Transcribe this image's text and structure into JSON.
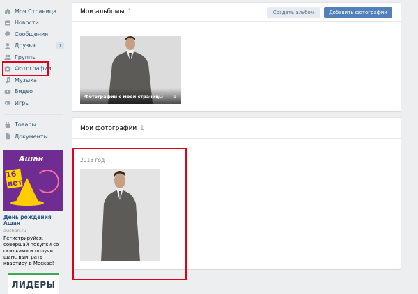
{
  "sidebar": {
    "items": [
      {
        "label": "Моя Страница",
        "icon": "home-icon"
      },
      {
        "label": "Новости",
        "icon": "news-icon"
      },
      {
        "label": "Сообщения",
        "icon": "messages-icon"
      },
      {
        "label": "Друзья",
        "icon": "friend-icon",
        "badge": "1"
      },
      {
        "label": "Группы",
        "icon": "groups-icon"
      },
      {
        "label": "Фотографии",
        "icon": "camera-icon"
      },
      {
        "label": "Музыка",
        "icon": "music-icon"
      },
      {
        "label": "Видео",
        "icon": "video-icon"
      },
      {
        "label": "Игры",
        "icon": "games-icon"
      }
    ],
    "items2": [
      {
        "label": "Товары",
        "icon": "goods-icon"
      },
      {
        "label": "Документы",
        "icon": "documents-icon"
      }
    ]
  },
  "ad": {
    "brand": "Ашан",
    "badge": "16 лет",
    "title": "День рождения Ашан",
    "domain": "auchan.ru",
    "text": "Регистрируйся, совершай покупки со скидками и получи шанс выиграть квартиру в Москве!"
  },
  "ad2": {
    "logo": "ЛИДЕРЫ"
  },
  "albums": {
    "title": "Мои альбомы",
    "count": "1",
    "create_label": "Создать альбом",
    "add_label": "Добавить фотографии",
    "album": {
      "caption": "Фотографии с моей страницы",
      "count": "1"
    }
  },
  "photos": {
    "title": "Мои фотографии",
    "count": "1",
    "year": "2018 год"
  },
  "colors": {
    "accent": "#5181b8",
    "link": "#285473",
    "highlight": "#e0001b",
    "background": "#edeef0"
  }
}
